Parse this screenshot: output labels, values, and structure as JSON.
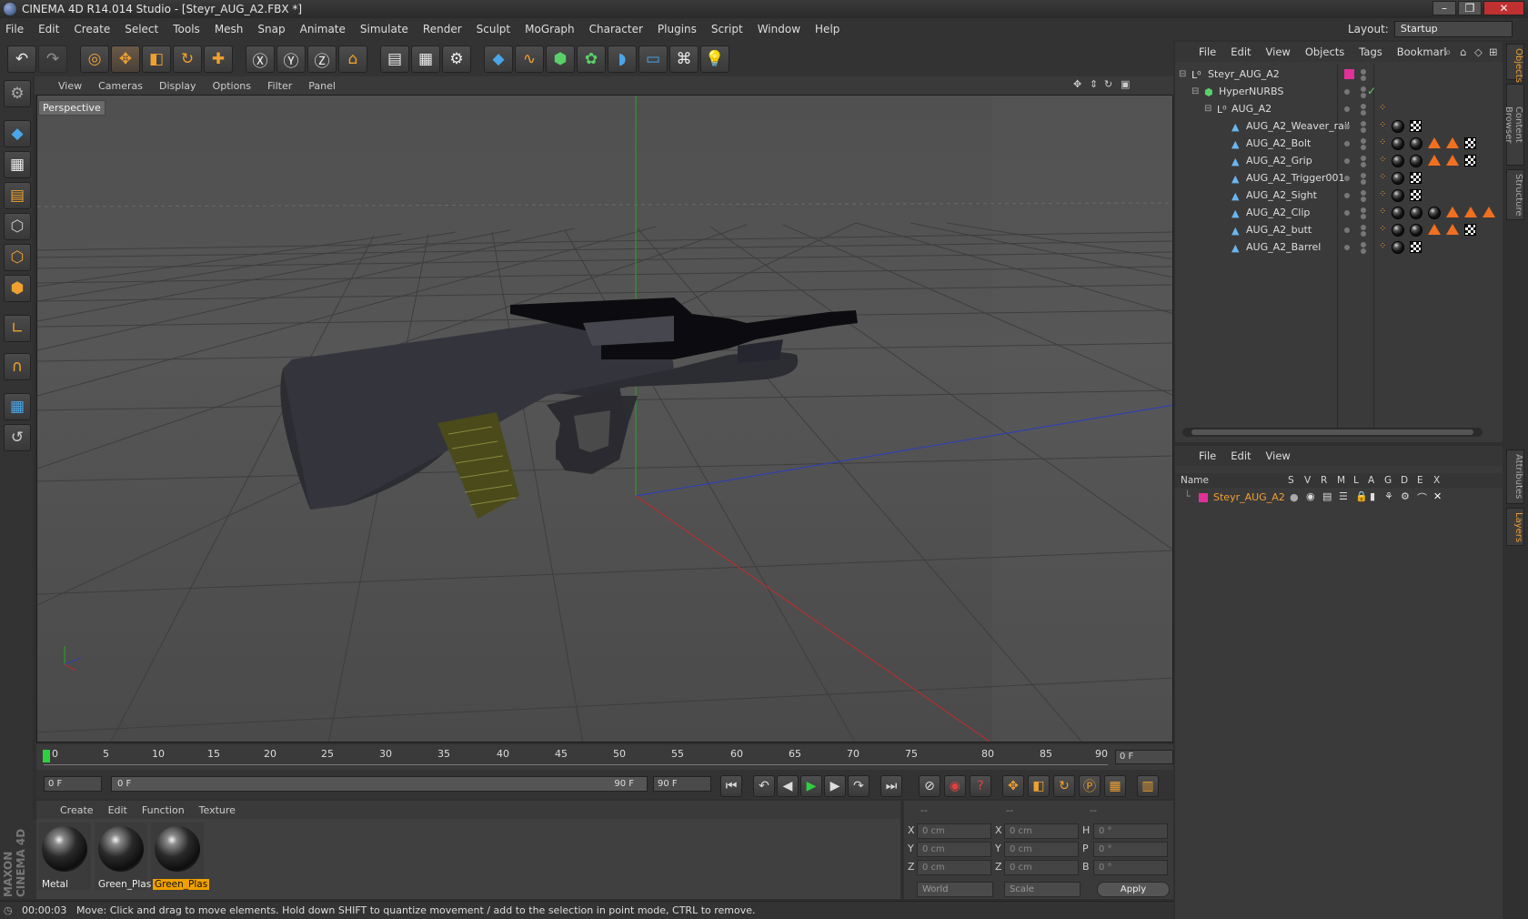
{
  "window": {
    "title": "CINEMA 4D R14.014 Studio - [Steyr_AUG_A2.FBX *]"
  },
  "menubar": [
    "File",
    "Edit",
    "Create",
    "Select",
    "Tools",
    "Mesh",
    "Snap",
    "Animate",
    "Simulate",
    "Render",
    "Sculpt",
    "MoGraph",
    "Character",
    "Plugins",
    "Script",
    "Window",
    "Help"
  ],
  "layout": {
    "label": "Layout:",
    "value": "Startup"
  },
  "viewport": {
    "menu": [
      "View",
      "Cameras",
      "Display",
      "Options",
      "Filter",
      "Panel"
    ],
    "camera_label": "Perspective"
  },
  "timeline": {
    "ticks": [
      "0",
      "5",
      "10",
      "15",
      "20",
      "25",
      "30",
      "35",
      "40",
      "45",
      "50",
      "55",
      "60",
      "65",
      "70",
      "75",
      "80",
      "85",
      "90"
    ],
    "current_frame": "0 F"
  },
  "transport": {
    "start_field": "0 F",
    "range_left": "0 F",
    "range_right": "90 F",
    "end_field": "90 F"
  },
  "materials": {
    "menu": [
      "Create",
      "Edit",
      "Function",
      "Texture"
    ],
    "items": [
      {
        "label": "Metal",
        "active": false
      },
      {
        "label": "Green_Plas",
        "active": false
      },
      {
        "label": "Green_Plas",
        "active": true
      }
    ]
  },
  "coordinates": {
    "headers": [
      "--",
      "--",
      "--"
    ],
    "rows": [
      {
        "a": "X",
        "av": "0 cm",
        "b": "X",
        "bv": "0 cm",
        "c": "H",
        "cv": "0 °"
      },
      {
        "a": "Y",
        "av": "0 cm",
        "b": "Y",
        "bv": "0 cm",
        "c": "P",
        "cv": "0 °"
      },
      {
        "a": "Z",
        "av": "0 cm",
        "b": "Z",
        "bv": "0 cm",
        "c": "B",
        "cv": "0 °"
      }
    ],
    "world": "World",
    "scale": "Scale",
    "apply": "Apply"
  },
  "maxon_logo": "MAXON CINEMA 4D",
  "status": {
    "time": "00:00:03",
    "message": "Move: Click and drag to move elements. Hold down SHIFT to quantize movement / add to the selection in point mode, CTRL to remove."
  },
  "objects": {
    "menu": [
      "File",
      "Edit",
      "View",
      "Objects",
      "Tags",
      "Bookmarl"
    ],
    "rows": [
      {
        "name": "Steyr_AUG_A2"
      },
      {
        "name": "HyperNURBS"
      },
      {
        "name": "AUG_A2"
      },
      {
        "name": "AUG_A2_Weaver_rail"
      },
      {
        "name": "AUG_A2_Bolt"
      },
      {
        "name": "AUG_A2_Grip"
      },
      {
        "name": "AUG_A2_Trigger001"
      },
      {
        "name": "AUG_A2_Sight"
      },
      {
        "name": "AUG_A2_Clip"
      },
      {
        "name": "AUG_A2_butt"
      },
      {
        "name": "AUG_A2_Barrel"
      }
    ]
  },
  "layers": {
    "menu": [
      "File",
      "Edit",
      "View"
    ],
    "columns": [
      "Name",
      "S",
      "V",
      "R",
      "M",
      "L",
      "A",
      "G",
      "D",
      "E",
      "X"
    ],
    "row": "Steyr_AUG_A2"
  },
  "right_tabs": [
    "Objects",
    "Content Browser",
    "Structure",
    "Attributes",
    "Layers"
  ],
  "colors": {
    "accent": "#f0a030",
    "layer_pink": "#e0309a",
    "active_orange": "#f0a000"
  }
}
